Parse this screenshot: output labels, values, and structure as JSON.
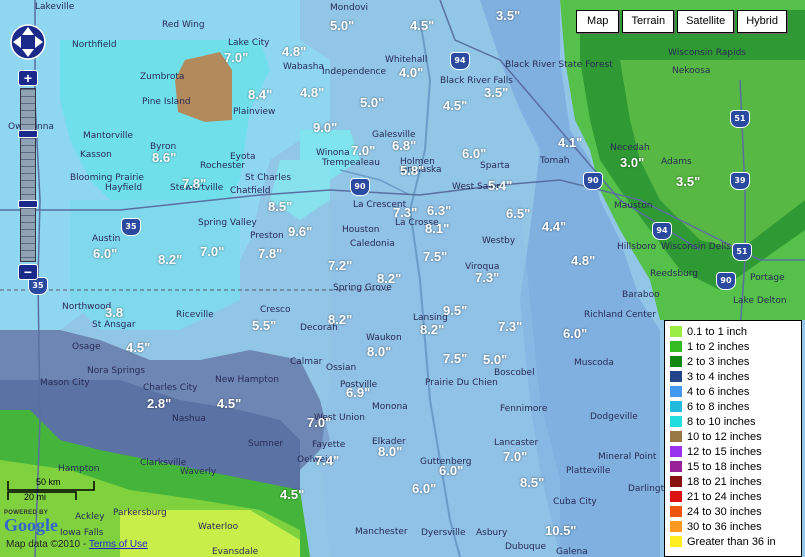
{
  "map_types": [
    "Map",
    "Terrain",
    "Satellite",
    "Hybrid"
  ],
  "legend": [
    {
      "label": "0.1 to 1 inch",
      "color": "#99ee44"
    },
    {
      "label": "1 to 2 inches",
      "color": "#33bb22"
    },
    {
      "label": "2 to 3 inches",
      "color": "#118811"
    },
    {
      "label": "3 to 4 inches",
      "color": "#224488"
    },
    {
      "label": "4 to 6 inches",
      "color": "#4499ee"
    },
    {
      "label": "6 to 8 inches",
      "color": "#22bbdd"
    },
    {
      "label": "8 to 10 inches",
      "color": "#22dddd"
    },
    {
      "label": "10 to 12 inches",
      "color": "#997744"
    },
    {
      "label": "12 to 15 inches",
      "color": "#9933ee"
    },
    {
      "label": "15 to 18 inches",
      "color": "#992299"
    },
    {
      "label": "18 to 21 inches",
      "color": "#881111"
    },
    {
      "label": "21 to 24 inches",
      "color": "#dd1111"
    },
    {
      "label": "24 to 30 inches",
      "color": "#ee5511"
    },
    {
      "label": "30 to 36 inches",
      "color": "#ff9922"
    },
    {
      "label": "Greater than 36 in",
      "color": "#ffee22"
    }
  ],
  "snow_values": [
    "3.5\"",
    "5.0\"",
    "4.5\"",
    "7.0\"",
    "4.8\"",
    "4.0\"",
    "8.4\"",
    "4.8\"",
    "5.0\"",
    "4.5\"",
    "3.5\"",
    "9.0\"",
    "7.0\"",
    "8.6\"",
    "6.8\"",
    "6.0\"",
    "4.1\"",
    "3.0\"",
    "7.8\"",
    "5.8\"",
    "5.4\"",
    "3.5\"",
    "8.5\"",
    "7.3\"",
    "6.3\"",
    "6.5\"",
    "4.4\"",
    "9.6\"",
    "8.1\"",
    "6.0\"",
    "8.2\"",
    "7.0\"",
    "7.8\"",
    "7.2\"",
    "7.5\"",
    "4.8\"",
    "8.2\"",
    "7.3\"",
    "3.8",
    "5.5\"",
    "8.2\"",
    "9.5\"",
    "7.3\"",
    "6.0\"",
    "4.5\"",
    "8.2\"",
    "8.0\"",
    "7.5\"",
    "5.0\"",
    "6.9\"",
    "2.8\"",
    "4.5\"",
    "7.0\"",
    "8.0\"",
    "7.0\"",
    "7.4\"",
    "6.0\"",
    "8.5\"",
    "4.5\"",
    "6.0\"",
    "10.5\""
  ],
  "towns": [
    "Lakeville",
    "Mondovi",
    "Red Wing",
    "Northfield",
    "Lake City",
    "Wabasha",
    "Zumbrota",
    "Pine Island",
    "Plainview",
    "Independence",
    "Whitehall",
    "Black River Falls",
    "Black River State Forest",
    "Wisconsin Rapids",
    "Nekoosa",
    "Owatonna",
    "Mantorville",
    "Kasson",
    "Byron",
    "Rochester",
    "Eyota",
    "Winona",
    "Galesville",
    "Trempealeau",
    "Holmen",
    "Onalaska",
    "Sparta",
    "Tomah",
    "Necedah",
    "Adams",
    "Blooming Prairie",
    "Hayfield",
    "Stewartville",
    "St Charles",
    "Chatfield",
    "La Crescent",
    "La Crosse",
    "West Salem",
    "Mauston",
    "Spring Valley",
    "Preston",
    "Houston",
    "Caledonia",
    "Westby",
    "Viroqua",
    "Hillsboro",
    "Wisconsin Dells",
    "Austin",
    "Spring Grove",
    "Reedsburg",
    "Portage",
    "Baraboo",
    "Lake Delton",
    "Northwood",
    "St Ansgar",
    "Riceville",
    "Cresco",
    "Decorah",
    "Lansing",
    "Richland Center",
    "Nora Springs",
    "Osage",
    "Waukon",
    "Calmar",
    "Ossian",
    "Prairie Du Chien",
    "Muscoda",
    "Boscobel",
    "Mason City",
    "Charles City",
    "New Hampton",
    "Postville",
    "Monona",
    "Fennimore",
    "Dodgeville",
    "Nashua",
    "West Union",
    "Lancaster",
    "Mineral Point",
    "Sumner",
    "Fayette",
    "Elkader",
    "Clarksville",
    "Waverly",
    "Oelwein",
    "Guttenberg",
    "Platteville",
    "Darlington",
    "Hampton",
    "Cuba City",
    "Parkersburg",
    "Ackley",
    "Iowa Falls",
    "Waterloo",
    "Manchester",
    "Dyersville",
    "Asbury",
    "Dubuque",
    "Galena",
    "Evansdale"
  ],
  "scale": {
    "km": "50 km",
    "mi": "20 mi"
  },
  "logo": {
    "powered": "POWERED BY",
    "name": "Google"
  },
  "copyright": {
    "prefix": "Map data ©2010 -",
    "link": "Terms of Use"
  },
  "highways": [
    "94",
    "51",
    "39",
    "90",
    "94",
    "90",
    "51",
    "90",
    "35",
    "35"
  ]
}
